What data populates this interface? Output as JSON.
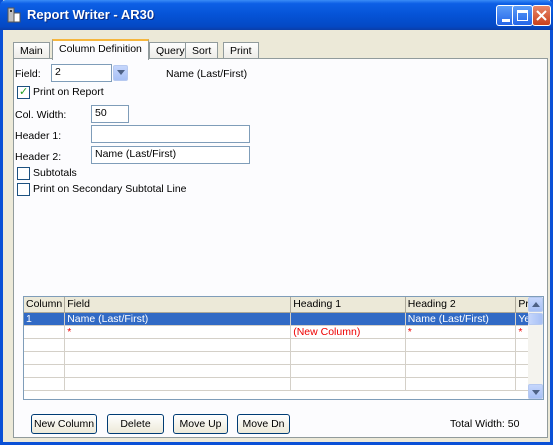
{
  "window": {
    "title": "Report Writer - AR30"
  },
  "tabs": [
    "Main",
    "Column Definition",
    "Query",
    "Sort",
    "Print"
  ],
  "form": {
    "field_label": "Field:",
    "field_value": "2",
    "field_description": "Name (Last/First)",
    "print_on_report_label": "Print on Report",
    "print_on_report_checked": true,
    "col_width_label": "Col. Width:",
    "col_width_value": "50",
    "header1_label": "Header 1:",
    "header1_value": "",
    "header2_label": "Header 2:",
    "header2_value": "Name (Last/First)",
    "subtotals_label": "Subtotals",
    "subtotals_checked": false,
    "secondary_subtotal_label": "Print on Secondary Subtotal Line",
    "secondary_subtotal_checked": false
  },
  "grid": {
    "columns": [
      "Column",
      "Field",
      "Heading 1",
      "Heading 2",
      "Print"
    ],
    "rows": [
      [
        "1",
        "Name (Last/First)",
        "",
        "Name (Last/First)",
        "Yes"
      ],
      [
        "",
        "*",
        "(New Column)",
        "*",
        "*"
      ]
    ]
  },
  "buttons": {
    "new_column": "New Column",
    "delete": "Delete",
    "move_up": "Move Up",
    "move_dn": "Move Dn"
  },
  "footer": {
    "total_width": "Total Width: 50"
  },
  "colors": {
    "title_bar": "#0553d6",
    "selection": "#316ac5",
    "new_row_text": "#e00000",
    "active_tab_accent": "#f6b63d"
  },
  "icons": [
    "app-icon",
    "minimize-icon",
    "maximize-icon",
    "close-icon",
    "dropdown-chevron-icon",
    "checkmark-icon",
    "scroll-up-icon",
    "scroll-down-icon"
  ]
}
